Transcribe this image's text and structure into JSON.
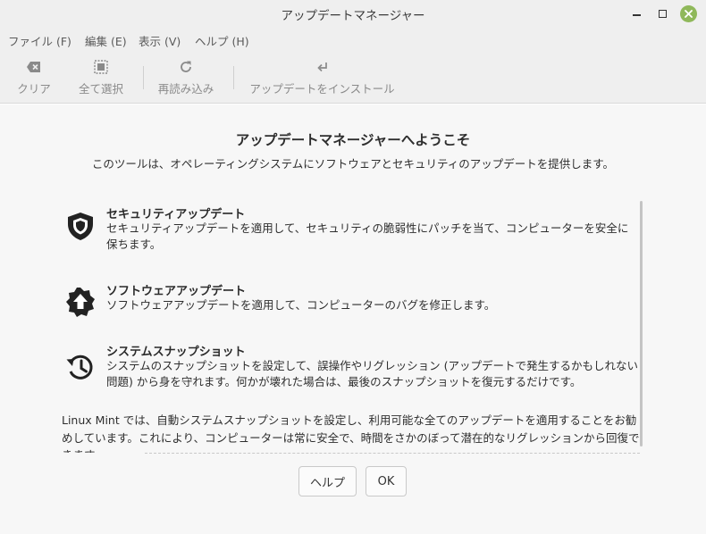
{
  "window": {
    "title": "アップデートマネージャー"
  },
  "controls": {
    "minimize_icon": "minimize-icon",
    "maximize_icon": "maximize-icon",
    "close_icon": "close-icon",
    "close_color": "#8fb85a"
  },
  "menu": [
    "ファイル (F)",
    "編集 (E)",
    "表示 (V)",
    "ヘルプ (H)"
  ],
  "toolbar": {
    "clear": {
      "label": "クリア",
      "icon": "backspace-icon"
    },
    "select_all": {
      "label": "全て選択",
      "icon": "select-all-icon"
    },
    "refresh": {
      "label": "再読み込み",
      "icon": "refresh-icon"
    },
    "install": {
      "label": "アップデートをインストール",
      "icon": "install-arrow-icon"
    }
  },
  "welcome": {
    "title": "アップデートマネージャーへようこそ",
    "subtitle": "このツールは、オペレーティングシステムにソフトウェアとセキュリティのアップデートを提供します。"
  },
  "features": [
    {
      "title": "セキュリティアップデート",
      "desc": "セキュリティアップデートを適用して、セキュリティの脆弱性にパッチを当て、コンピューターを安全に保ちます。",
      "icon": "shield-icon"
    },
    {
      "title": "ソフトウェアアップデート",
      "desc": "ソフトウェアアップデートを適用して、コンピューターのバグを修正します。",
      "icon": "upgrade-badge-icon"
    },
    {
      "title": "システムスナップショット",
      "desc": "システムのスナップショットを設定して、誤操作やリグレッション (アップデートで発生するかもしれない問題) から身を守れます。何かが壊れた場合は、最後のスナップショットを復元するだけです。",
      "icon": "history-icon"
    }
  ],
  "note": "Linux Mint では、自動システムスナップショットを設定し、利用可能な全てのアップデートを適用することをお勧めしています。これにより、コンピューターは常に安全で、時間をさかのぼって潜在的なリグレッションから回復できます。",
  "buttons": {
    "help": "ヘルプ",
    "ok": "OK"
  }
}
